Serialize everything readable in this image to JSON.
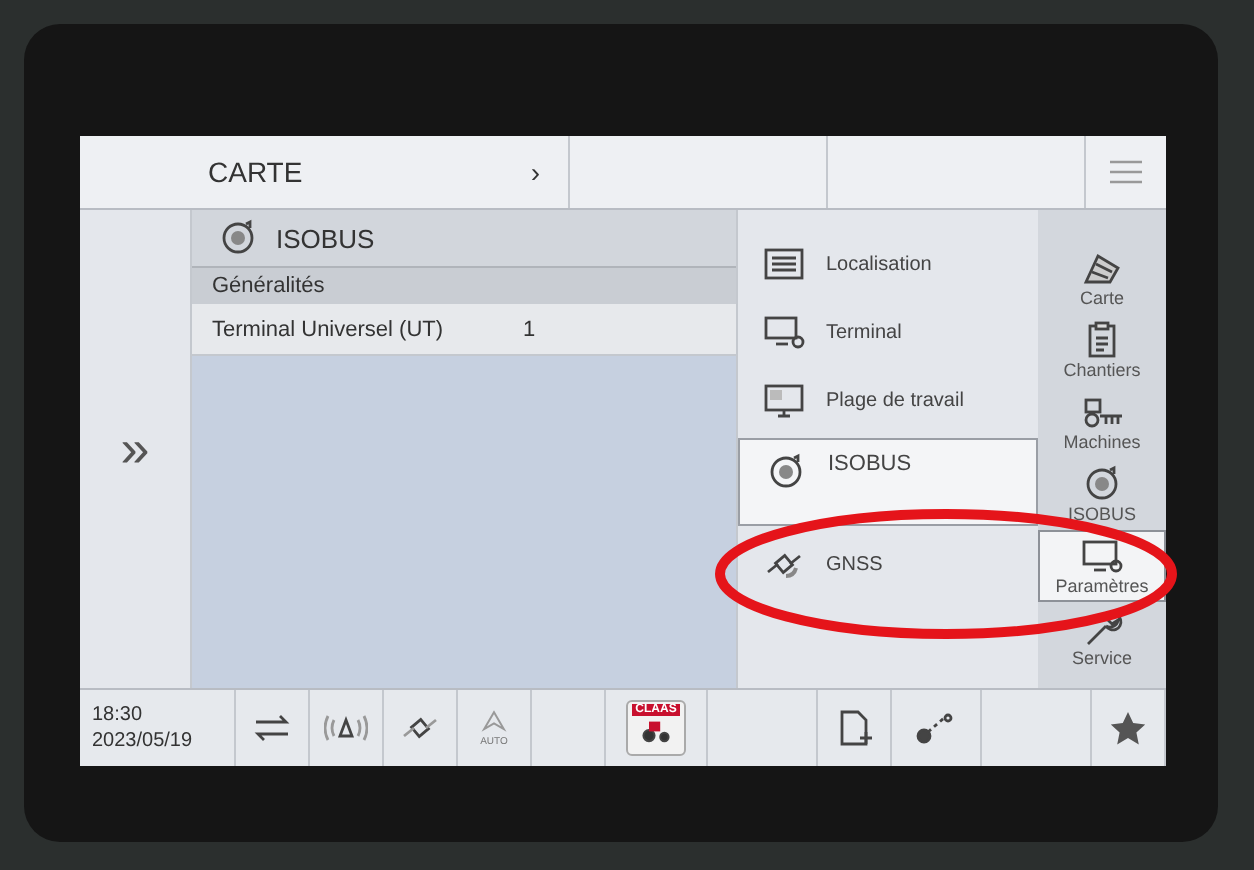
{
  "breadcrumb": {
    "title": "CARTE",
    "chevron": "›"
  },
  "expand_toggle": "»",
  "panel": {
    "title": "ISOBUS",
    "section": "Généralités",
    "rows": [
      {
        "label": "Terminal Universel (UT)",
        "value": "1"
      }
    ]
  },
  "submenu": [
    {
      "label": "Localisation",
      "selected": false
    },
    {
      "label": "Terminal",
      "selected": false
    },
    {
      "label": "Plage de travail",
      "selected": false
    },
    {
      "label": "ISOBUS",
      "selected": true
    },
    {
      "label": "GNSS",
      "selected": false
    }
  ],
  "sidebar": [
    {
      "label": "Carte",
      "selected": false
    },
    {
      "label": "Chantiers",
      "selected": false
    },
    {
      "label": "Machines",
      "selected": false
    },
    {
      "label": "ISOBUS",
      "selected": false
    },
    {
      "label": "Paramètres",
      "selected": true
    },
    {
      "label": "Service",
      "selected": false
    }
  ],
  "status_bar": {
    "time": "18:30",
    "date": "2023/05/19",
    "auto_label": "AUTO",
    "app_logo": "CLAAS"
  }
}
